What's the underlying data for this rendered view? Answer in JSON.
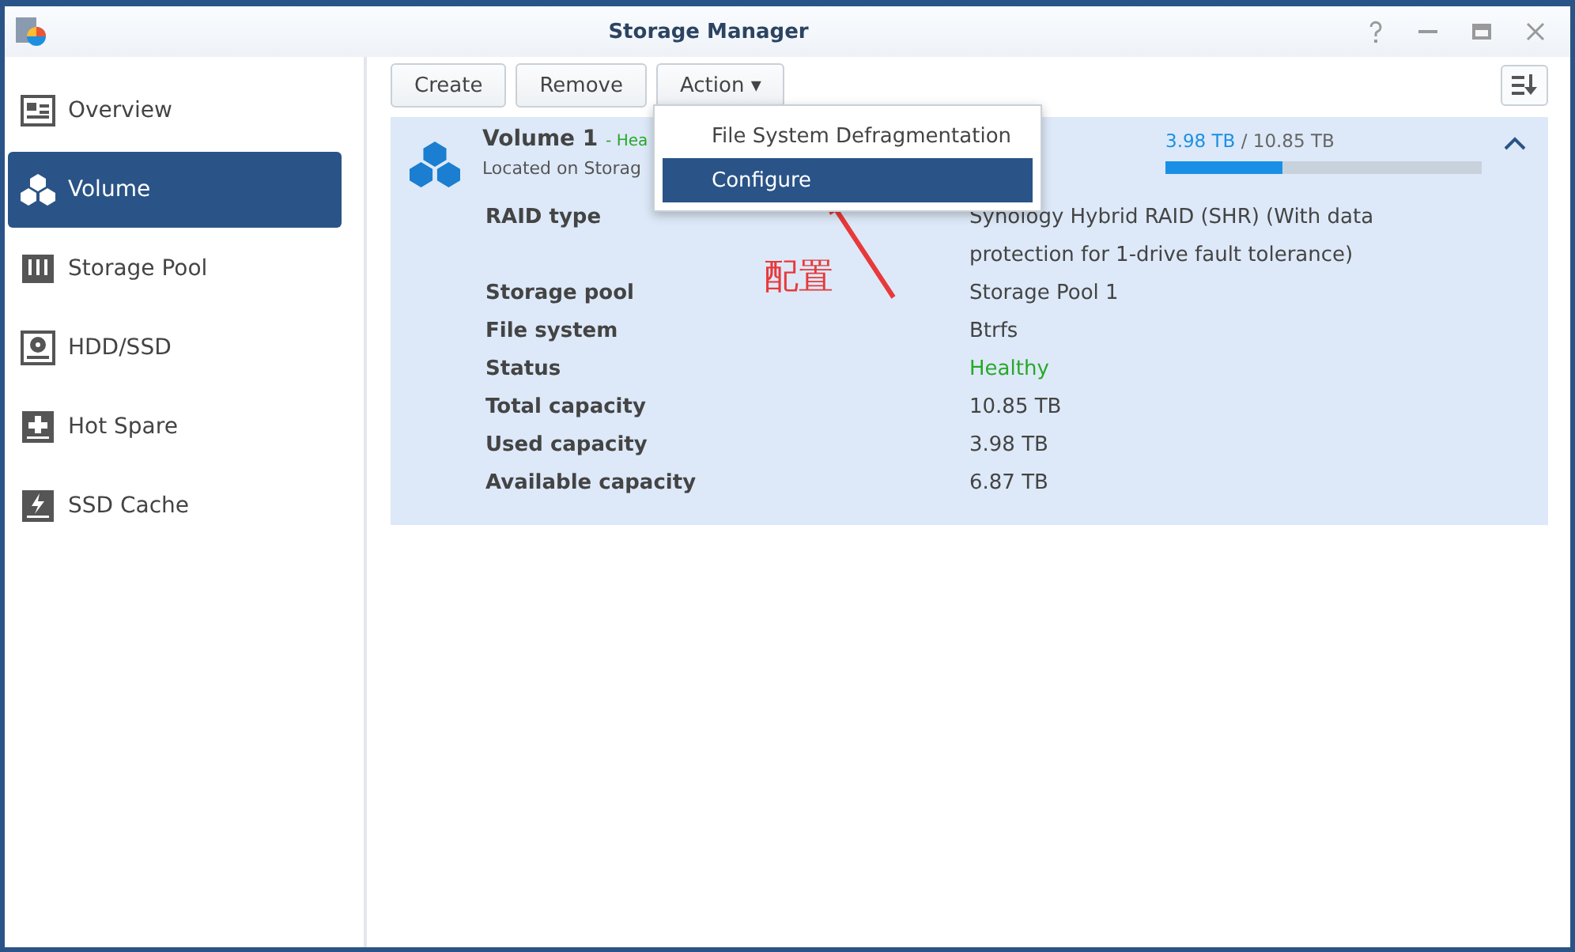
{
  "window": {
    "title": "Storage Manager"
  },
  "sidebar": {
    "items": [
      {
        "label": "Overview",
        "selected": false
      },
      {
        "label": "Volume",
        "selected": true
      },
      {
        "label": "Storage Pool",
        "selected": false
      },
      {
        "label": "HDD/SSD",
        "selected": false
      },
      {
        "label": "Hot Spare",
        "selected": false
      },
      {
        "label": "SSD Cache",
        "selected": false
      }
    ]
  },
  "toolbar": {
    "buttons": [
      {
        "label": "Create"
      },
      {
        "label": "Remove"
      },
      {
        "label": "Action ▾"
      }
    ]
  },
  "action_menu": {
    "items": [
      {
        "label": "File System Defragmentation",
        "selected": false
      },
      {
        "label": "Configure",
        "selected": true
      }
    ]
  },
  "volume": {
    "name": "Volume 1",
    "status_prefix": "- ",
    "status": "Hea",
    "location": "Located on Storag",
    "used": "3.98 TB",
    "total": "/ 10.85 TB",
    "level": 0.37,
    "expanded": true,
    "details": [
      {
        "label": "RAID type",
        "value": "Synology Hybrid RAID (SHR) (With data protection for 1-drive fault tolerance)",
        "kind": "plain"
      },
      {
        "label": "Storage pool",
        "value": "Storage Pool 1",
        "kind": "plain"
      },
      {
        "label": "File system",
        "value": "Btrfs",
        "kind": "plain"
      },
      {
        "label": "Status",
        "value": "Healthy",
        "kind": "status"
      },
      {
        "label": "Total capacity",
        "value": "10.85 TB",
        "kind": "plain"
      },
      {
        "label": "Used capacity",
        "value": "3.98 TB",
        "kind": "plain"
      },
      {
        "label": "Available capacity",
        "value": "6.87 TB",
        "kind": "plain"
      }
    ]
  },
  "annotation": {
    "text": "配置"
  }
}
